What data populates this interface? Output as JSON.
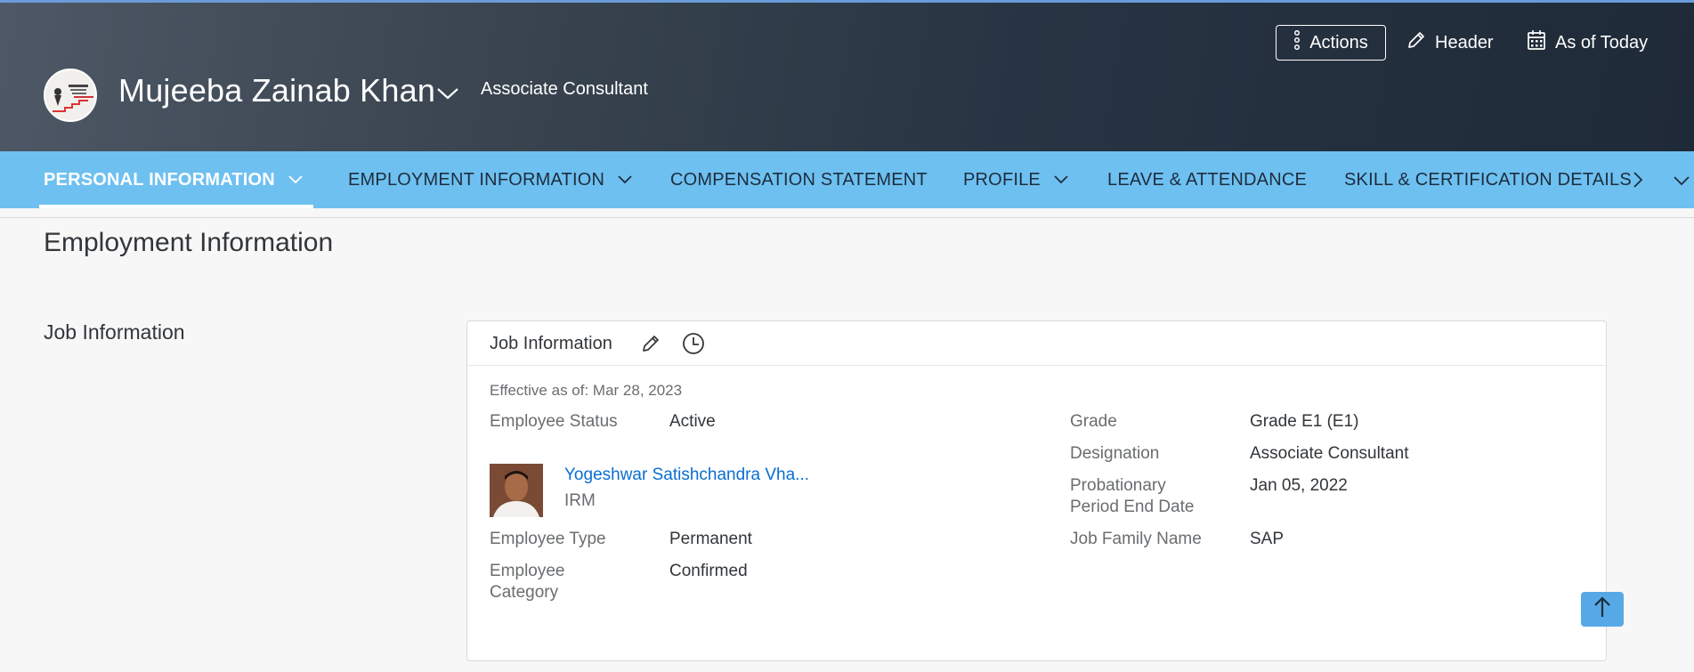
{
  "employee": {
    "name": "Mujeeba Zainab Khan",
    "title": "Associate Consultant"
  },
  "header_actions": {
    "actions_label": "Actions",
    "header_label": "Header",
    "date_label": "As of Today"
  },
  "nav": {
    "tabs": [
      {
        "label": "PERSONAL INFORMATION",
        "active": true,
        "has_dropdown": true
      },
      {
        "label": "EMPLOYMENT INFORMATION",
        "active": false,
        "has_dropdown": true
      },
      {
        "label": "COMPENSATION STATEMENT",
        "active": false,
        "has_dropdown": false
      },
      {
        "label": "PROFILE",
        "active": false,
        "has_dropdown": true
      },
      {
        "label": "LEAVE & ATTENDANCE",
        "active": false,
        "has_dropdown": false
      },
      {
        "label": "SKILL & CERTIFICATION DETAILS",
        "active": false,
        "has_dropdown": false
      }
    ]
  },
  "content": {
    "section_title": "Employment Information",
    "subsection_title": "Job Information"
  },
  "job_card": {
    "title": "Job Information",
    "effective": "Effective as of: Mar 28, 2023",
    "employee_status_label": "Employee Status",
    "employee_status_value": "Active",
    "manager_name": "Yogeshwar Satishchandra Vha...",
    "manager_role": "IRM",
    "employee_type_label": "Employee Type",
    "employee_type_value": "Permanent",
    "employee_category_label_1": "Employee",
    "employee_category_label_2": "Category",
    "employee_category_value": "Confirmed",
    "grade_label": "Grade",
    "grade_value": "Grade E1 (E1)",
    "designation_label": "Designation",
    "designation_value": "Associate Consultant",
    "probation_label_1": "Probationary",
    "probation_label_2": "Period End Date",
    "probation_value": "Jan 05, 2022",
    "job_family_label": "Job Family Name",
    "job_family_value": "SAP"
  },
  "colors": {
    "nav_bg": "#6ec0f0",
    "link": "#0a6ed1",
    "header_bg": "#2b3645"
  }
}
